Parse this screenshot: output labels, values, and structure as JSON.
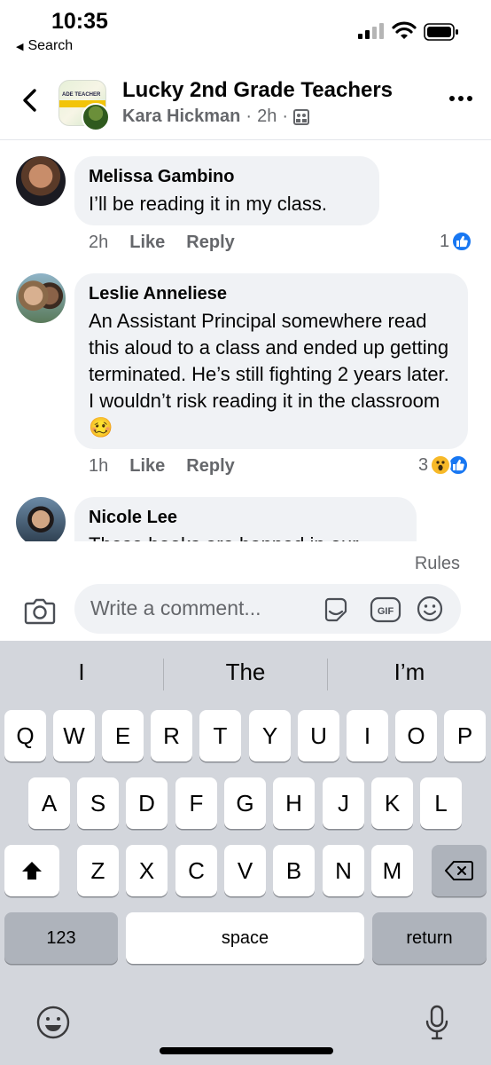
{
  "status_bar": {
    "time": "10:35",
    "back_app": "Search"
  },
  "header": {
    "title": "Lucky 2nd Grade Teachers",
    "author": "Kara Hickman",
    "time_ago": "2h",
    "separator": "·",
    "avatar_text": "ADE TEACHER"
  },
  "comments": [
    {
      "name": "Melissa Gambino",
      "text": "I’ll be reading it in my class.",
      "time": "2h",
      "like_label": "Like",
      "reply_label": "Reply",
      "reaction_count": "1",
      "reactions": [
        "like"
      ]
    },
    {
      "name": "Leslie Anneliese",
      "text": "An Assistant Principal somewhere read this aloud to a class and ended up getting terminated. He’s still fighting 2 years later. I wouldn’t risk reading it in the classroom 🥴",
      "time": "1h",
      "like_label": "Like",
      "reply_label": "Reply",
      "reaction_count": "3",
      "reactions": [
        "wow",
        "like"
      ]
    },
    {
      "name": "Nicole Lee",
      "text": "These books are banned in our"
    }
  ],
  "composer": {
    "rules_label": "Rules",
    "placeholder": "Write a comment...",
    "gif_label": "GIF"
  },
  "keyboard": {
    "suggestions": [
      "I",
      "The",
      "I’m"
    ],
    "row1": [
      "Q",
      "W",
      "E",
      "R",
      "T",
      "Y",
      "U",
      "I",
      "O",
      "P"
    ],
    "row2": [
      "A",
      "S",
      "D",
      "F",
      "G",
      "H",
      "J",
      "K",
      "L"
    ],
    "row3": [
      "Z",
      "X",
      "C",
      "V",
      "B",
      "N",
      "M"
    ],
    "numbers_label": "123",
    "space_label": "space",
    "return_label": "return"
  },
  "colors": {
    "facebook_blue": "#1877f2",
    "bubble_gray": "#f0f2f5",
    "secondary_text": "#65676b",
    "keyboard_bg": "#d3d6dc"
  }
}
